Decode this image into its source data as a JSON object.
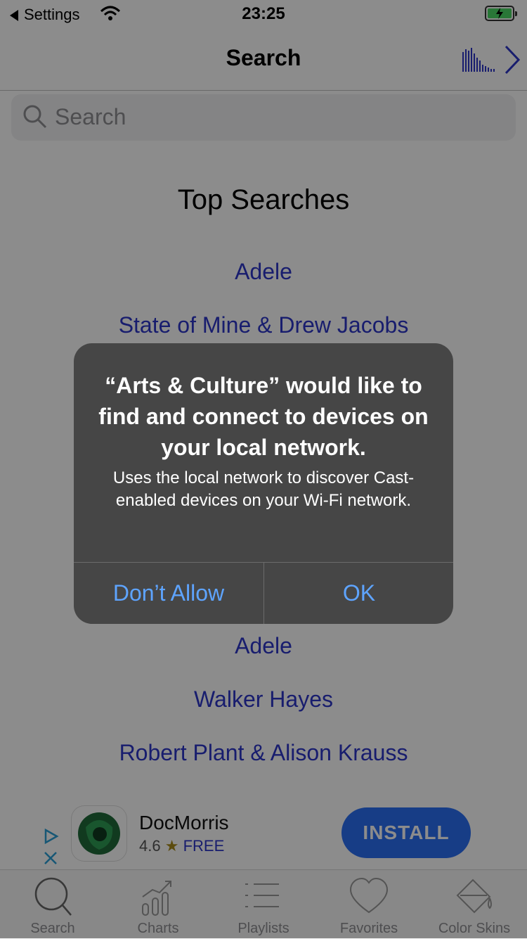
{
  "status_bar": {
    "back_label": "Settings",
    "time": "23:25"
  },
  "nav": {
    "title": "Search"
  },
  "search": {
    "placeholder": "Search"
  },
  "top_searches": {
    "title": "Top Searches",
    "items": [
      "Adele",
      "State of Mine & Drew Jacobs",
      "Adele",
      "Walker Hayes",
      "Robert Plant & Alison Krauss"
    ]
  },
  "ad": {
    "app_name": "DocMorris",
    "rating": "4.6",
    "star": "★",
    "price": "FREE",
    "install_label": "INSTALL"
  },
  "tabs": [
    {
      "label": "Search",
      "icon": "magnifier-icon"
    },
    {
      "label": "Charts",
      "icon": "chart-icon"
    },
    {
      "label": "Playlists",
      "icon": "list-icon"
    },
    {
      "label": "Favorites",
      "icon": "heart-icon"
    },
    {
      "label": "Color Skins",
      "icon": "paint-bucket-icon"
    }
  ],
  "alert": {
    "title": "“Arts & Culture” would like to find and connect to devices on your local network.",
    "message": "Uses the local network to discover Cast-enabled devices on your Wi-Fi network.",
    "deny_label": "Don’t Allow",
    "ok_label": "OK"
  },
  "colors": {
    "link": "#2d36c8",
    "alert_button": "#5ea4ff",
    "install_button": "#2b6ff4"
  }
}
